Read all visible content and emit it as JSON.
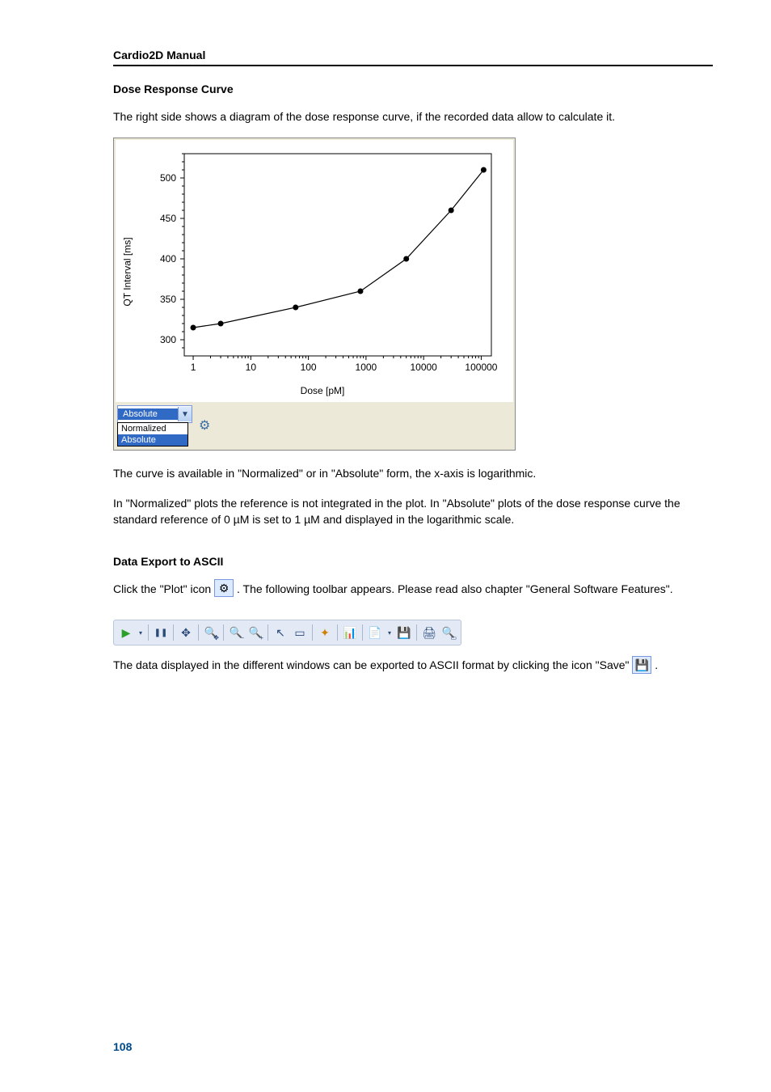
{
  "header": {
    "title": "Cardio2D Manual"
  },
  "section1": {
    "heading": "Dose Response Curve",
    "intro": "The right side shows a diagram of the dose response curve, if the recorded data allow to calculate it.",
    "para2": "The curve is available in \"Normalized\" or in \"Absolute\" form, the x-axis is logarithmic.",
    "para3": "In \"Normalized\" plots the reference is not integrated in the plot. In \"Absolute\" plots of the dose response curve the standard reference of 0 µM is set to 1 µM and displayed in the logarithmic scale."
  },
  "chart_data": {
    "type": "line",
    "ylabel": "QT Interval [ms]",
    "xlabel": "Dose [pM]",
    "ylim": [
      280,
      530
    ],
    "yticks": [
      300,
      350,
      400,
      450,
      500
    ],
    "xticks": [
      1,
      10,
      100,
      1000,
      10000,
      100000
    ],
    "x": [
      1,
      10,
      100,
      1000,
      10000,
      100000
    ],
    "y": [
      315,
      320,
      340,
      360,
      400,
      460,
      510
    ],
    "x_drawn": [
      1,
      3,
      60,
      800,
      5000,
      30000,
      110000
    ]
  },
  "chart_controls": {
    "selected": "Absolute",
    "options": [
      "Normalized",
      "Absolute"
    ],
    "plot_icon": "plot-settings-icon"
  },
  "section2": {
    "heading": "Data Export to ASCII",
    "para1_a": "Click the \"Plot\" icon ",
    "para1_b": ". The following toolbar appears. Please read also chapter \"General Software Features\".",
    "para2_a": "The data displayed in the different windows can be exported to ASCII format by clicking the icon \"Save\" ",
    "para2_b": "."
  },
  "toolbar": {
    "items": [
      {
        "name": "play-icon",
        "glyph": "▶",
        "color": "#2aa02a"
      },
      {
        "name": "dropdown-icon",
        "glyph": "▾",
        "small": true
      },
      {
        "sep": true
      },
      {
        "name": "pause-icon",
        "glyph": "❚❚",
        "fs": 10
      },
      {
        "sep": true
      },
      {
        "name": "move-icon",
        "glyph": "✥"
      },
      {
        "sep": true
      },
      {
        "name": "zoom-fit-icon",
        "glyph": "🔍",
        "sub": "✥"
      },
      {
        "sep": true
      },
      {
        "name": "zoom-out-icon",
        "glyph": "🔍",
        "sub": "−"
      },
      {
        "name": "zoom-in-icon",
        "glyph": "🔍",
        "sub": "+"
      },
      {
        "sep": true
      },
      {
        "name": "pointer-icon",
        "glyph": "↖"
      },
      {
        "name": "select-rect-icon",
        "glyph": "▭"
      },
      {
        "sep": true
      },
      {
        "name": "center-icon",
        "glyph": "✦",
        "color": "#d08000"
      },
      {
        "sep": true
      },
      {
        "name": "chart-icon",
        "glyph": "📊"
      },
      {
        "sep": true
      },
      {
        "name": "copy-icon",
        "glyph": "📄"
      },
      {
        "name": "copy-dropdown-icon",
        "glyph": "▾",
        "small": true
      },
      {
        "name": "save-icon",
        "glyph": "💾"
      },
      {
        "sep": true
      },
      {
        "name": "print-icon",
        "glyph": "🖨"
      },
      {
        "name": "preview-icon",
        "glyph": "🔍",
        "sub": "▭"
      }
    ]
  },
  "inline_icons": {
    "plot_gear": "⚙",
    "save_disk": "💾"
  },
  "footer": {
    "page": "108"
  }
}
